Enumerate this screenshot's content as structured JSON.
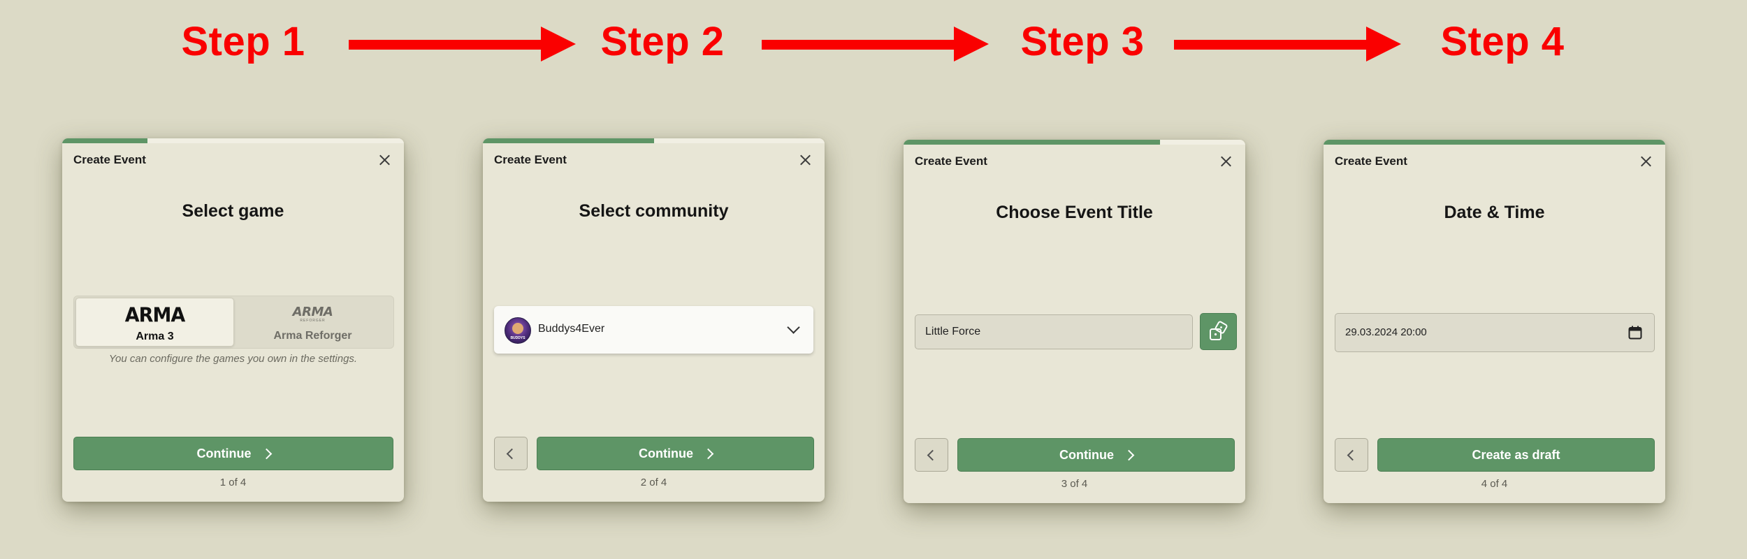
{
  "steps": [
    "Step 1",
    "Step 2",
    "Step 3",
    "Step 4"
  ],
  "colors": {
    "arrow": "#fa0000",
    "accent_green": "#5e9566",
    "dialog_bg": "#e8e6d6",
    "page_bg": "#dcdac6"
  },
  "dialogs": [
    {
      "header": "Create Event",
      "progress": 0.25,
      "title": "Select game",
      "games": [
        {
          "logo": "ARMA",
          "name": "Arma 3",
          "selected": true
        },
        {
          "logo": "ARMA",
          "logo_sub": "REFORGER",
          "name": "Arma Reforger",
          "selected": false
        }
      ],
      "hint": "You can configure the games you own in the settings.",
      "continue_label": "Continue",
      "page": "1 of 4"
    },
    {
      "header": "Create Event",
      "progress": 0.5,
      "title": "Select community",
      "community": {
        "name": "Buddys4Ever",
        "avatar_text": "BUDDYS"
      },
      "continue_label": "Continue",
      "page": "2 of 4"
    },
    {
      "header": "Create Event",
      "progress": 0.75,
      "title": "Choose Event Title",
      "event_title_value": "Little Force",
      "continue_label": "Continue",
      "page": "3 of 4"
    },
    {
      "header": "Create Event",
      "progress": 1.0,
      "title": "Date & Time",
      "datetime_value": "29.03.2024 20:00",
      "submit_label": "Create as draft",
      "page": "4 of 4"
    }
  ],
  "icons": {
    "close": "close-icon",
    "chevron_right": "chevron-right-icon",
    "chevron_left": "chevron-left-icon",
    "chevron_down": "chevron-down-icon",
    "randomize": "dice-icon",
    "calendar": "calendar-icon"
  }
}
